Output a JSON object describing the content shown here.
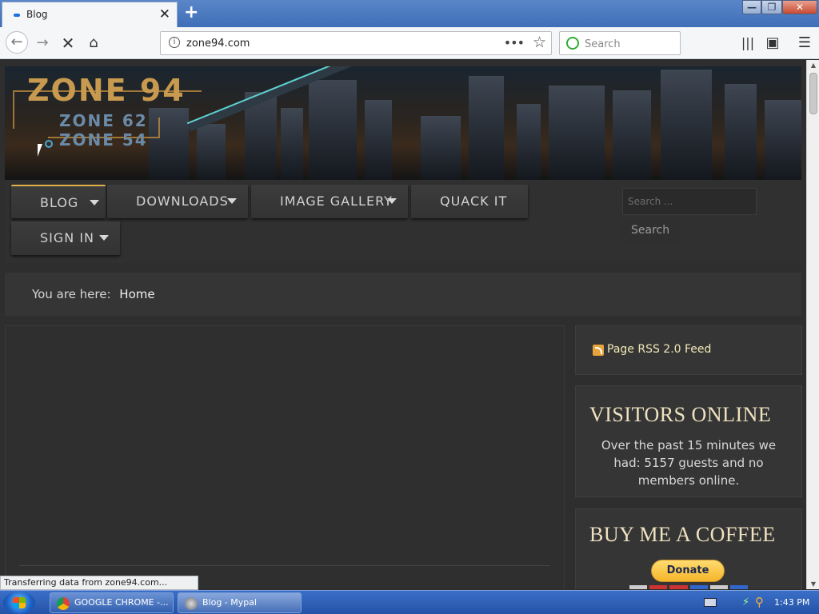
{
  "browser": {
    "tab_title": "Blog",
    "url": "zone94.com",
    "search_placeholder": "Search",
    "status_text": "Transferring data from zone94.com..."
  },
  "site": {
    "logo": {
      "main": "ZONE 94",
      "sub1": "ZONE 62",
      "sub2": "ZONE 54"
    },
    "menu": {
      "items": [
        {
          "label": "BLOG",
          "has_dropdown": true,
          "active": true
        },
        {
          "label": "DOWNLOADS",
          "has_dropdown": true
        },
        {
          "label": "IMAGE GALLERY",
          "has_dropdown": true
        },
        {
          "label": "QUACK IT",
          "has_dropdown": false
        },
        {
          "label": "SIGN IN",
          "has_dropdown": true
        }
      ],
      "search_placeholder": "Search ...",
      "search_button": "Search"
    },
    "breadcrumb": {
      "prefix": "You are here:",
      "current": "Home"
    },
    "sidebar": {
      "rss_label": "Page RSS 2.0 Feed",
      "visitors_title": "VISITORS ONLINE",
      "visitors_text": "Over the past 15 minutes we had: 5157 guests and no members online.",
      "coffee_title": "BUY ME A COFFEE",
      "donate_label": "Donate"
    }
  },
  "taskbar": {
    "items": [
      {
        "label": "GOOGLE CHROME -..."
      },
      {
        "label": "Blog - Mypal"
      }
    ],
    "clock": "1:43 PM"
  },
  "colors": {
    "accent": "#e0b14a",
    "page_bg": "#2e2e2e",
    "widget_title": "#efe2c0",
    "rss_text": "#f1e8b7"
  }
}
